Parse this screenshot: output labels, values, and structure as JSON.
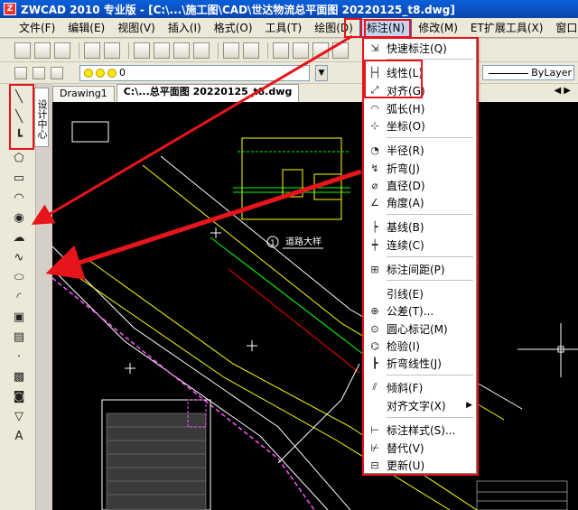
{
  "window": {
    "title": "ZWCAD 2010 专业版 - [C:\\...\\施工图\\CAD\\世达物流总平面图 20220125_t8.dwg]"
  },
  "menubar": {
    "items": [
      "文件(F)",
      "编辑(E)",
      "视图(V)",
      "插入(I)",
      "格式(O)",
      "工具(T)",
      "绘图(D)",
      "标注(N)",
      "修改(M)",
      "ET扩展工具(X)",
      "窗口"
    ]
  },
  "layer": {
    "current": "0",
    "linetype": "ByLayer"
  },
  "side_tab": {
    "label": "设计中心"
  },
  "doc_tabs": {
    "items": [
      "Drawing1",
      "C:\\...总平面图 20220125_t8.dwg"
    ],
    "nav": "◀ ▶"
  },
  "canvas": {
    "labels": {
      "road_section": "道路大样",
      "section_no": "1"
    }
  },
  "dimension_menu": {
    "items": [
      {
        "label": "快速标注(Q)",
        "icon": "quick-dimension-icon"
      },
      {
        "label": "线性(L)",
        "icon": "linear-dimension-icon"
      },
      {
        "label": "对齐(G)",
        "icon": "aligned-dimension-icon"
      },
      {
        "label": "弧长(H)",
        "icon": "arc-length-icon"
      },
      {
        "label": "坐标(O)",
        "icon": "ordinate-icon"
      },
      {
        "label": "半径(R)",
        "icon": "radius-icon"
      },
      {
        "label": "折弯(J)",
        "icon": "jogged-icon"
      },
      {
        "label": "直径(D)",
        "icon": "diameter-icon"
      },
      {
        "label": "角度(A)",
        "icon": "angle-icon"
      },
      {
        "label": "基线(B)",
        "icon": "baseline-icon"
      },
      {
        "label": "连续(C)",
        "icon": "continue-icon"
      },
      {
        "label": "标注间距(P)",
        "icon": "dimension-space-icon"
      },
      {
        "label": "引线(E)",
        "icon": ""
      },
      {
        "label": "公差(T)...",
        "icon": "tolerance-icon"
      },
      {
        "label": "圆心标记(M)",
        "icon": "center-mark-icon"
      },
      {
        "label": "检验(I)",
        "icon": "inspection-icon"
      },
      {
        "label": "折弯线性(J)",
        "icon": "jogged-linear-icon"
      },
      {
        "label": "倾斜(F)",
        "icon": "oblique-icon"
      },
      {
        "label": "对齐文字(X)",
        "icon": "",
        "submenu": "▶"
      },
      {
        "label": "标注样式(S)...",
        "icon": "dimension-style-icon"
      },
      {
        "label": "替代(V)",
        "icon": "override-icon"
      },
      {
        "label": "更新(U)",
        "icon": "update-icon"
      }
    ]
  },
  "colors": {
    "highlight": "#e8141c",
    "title_bar": "#0a5fd8",
    "menu_open": "#c6d3ef"
  }
}
